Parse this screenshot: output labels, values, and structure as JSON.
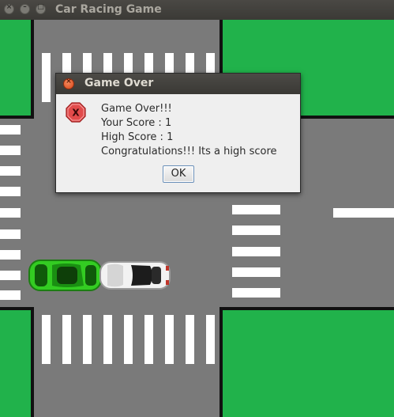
{
  "window": {
    "title": "Car Racing Game",
    "close_glyph": "×",
    "min_glyph": "–",
    "max_glyph": "□"
  },
  "dialog": {
    "title": "Game Over",
    "close_glyph": "×",
    "icon": "error-icon",
    "icon_glyph": "X",
    "lines": [
      "Game Over!!!",
      "Your Score : 1",
      "High Score : 1",
      "Congratulations!!! Its a high score"
    ],
    "ok_label": "OK"
  },
  "colors": {
    "grass": "#21b24b",
    "road": "#7a7a7a",
    "player_car": "#33cc22",
    "other_car": "#f2f2f2",
    "error_icon": "#e24b4b"
  }
}
